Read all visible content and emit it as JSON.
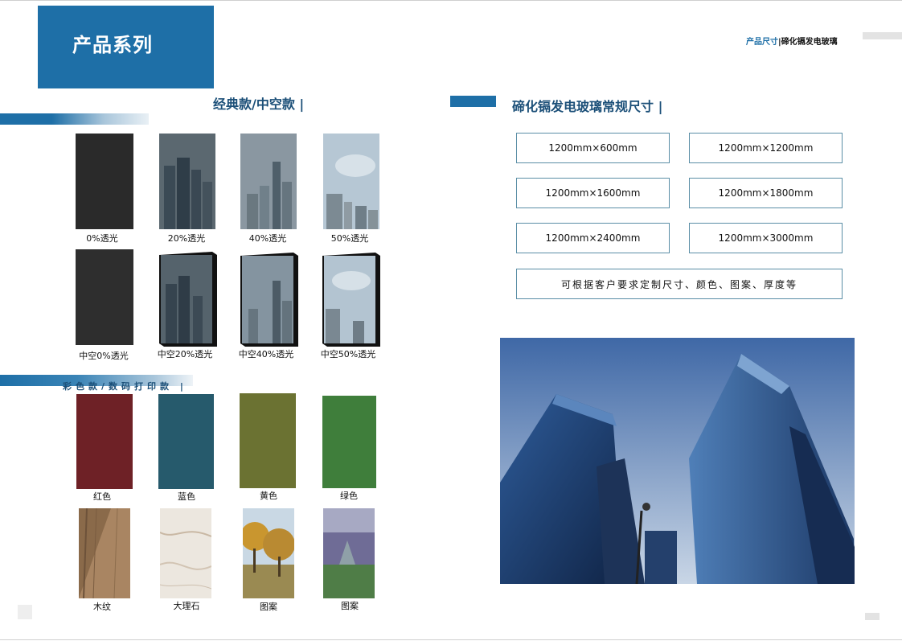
{
  "header": {
    "title": "产品系列",
    "breadcrumb_section": "产品尺寸",
    "breadcrumb_sep": "|",
    "breadcrumb_product": "碲化镉发电玻璃"
  },
  "classic": {
    "heading": "经典款/中空款",
    "items": [
      {
        "label": "0%透光",
        "color": "#2a2a2a"
      },
      {
        "label": "20%透光",
        "color": "#4b5a63"
      },
      {
        "label": "40%透光",
        "color": "#7f8d97"
      },
      {
        "label": "50%透光",
        "color": "#a9bccb"
      },
      {
        "label": "中空0%透光",
        "color": "#2e2e2e"
      },
      {
        "label": "中空20%透光",
        "color": "#505d66"
      },
      {
        "label": "中空40%透光",
        "color": "#7a8893"
      },
      {
        "label": "中空50%透光",
        "color": "#a7b8c6"
      }
    ]
  },
  "color_series": {
    "heading": "彩色款/数码打印款",
    "items": [
      {
        "label": "红色",
        "color": "#6e2126"
      },
      {
        "label": "蓝色",
        "color": "#265a6c"
      },
      {
        "label": "黄色",
        "color": "#6b7232"
      },
      {
        "label": "绿色",
        "color": "#3f7e3b"
      },
      {
        "label": "木纹",
        "color": "#8a6a4a"
      },
      {
        "label": "大理石",
        "color": "#ebe5dc"
      },
      {
        "label": "图案",
        "color": "#b7933f"
      },
      {
        "label": "图案",
        "color": "#5d6c86"
      }
    ]
  },
  "sizes": {
    "heading": "碲化镉发电玻璃常规尺寸",
    "items": [
      "1200mm×600mm",
      "1200mm×1200mm",
      "1200mm×1600mm",
      "1200mm×1800mm",
      "1200mm×2400mm",
      "1200mm×3000mm"
    ],
    "note": "可根据客户要求定制尺寸、颜色、图案、厚度等"
  },
  "colors": {
    "brand_blue": "#1e6fa7",
    "heading_blue": "#1b4f78"
  }
}
